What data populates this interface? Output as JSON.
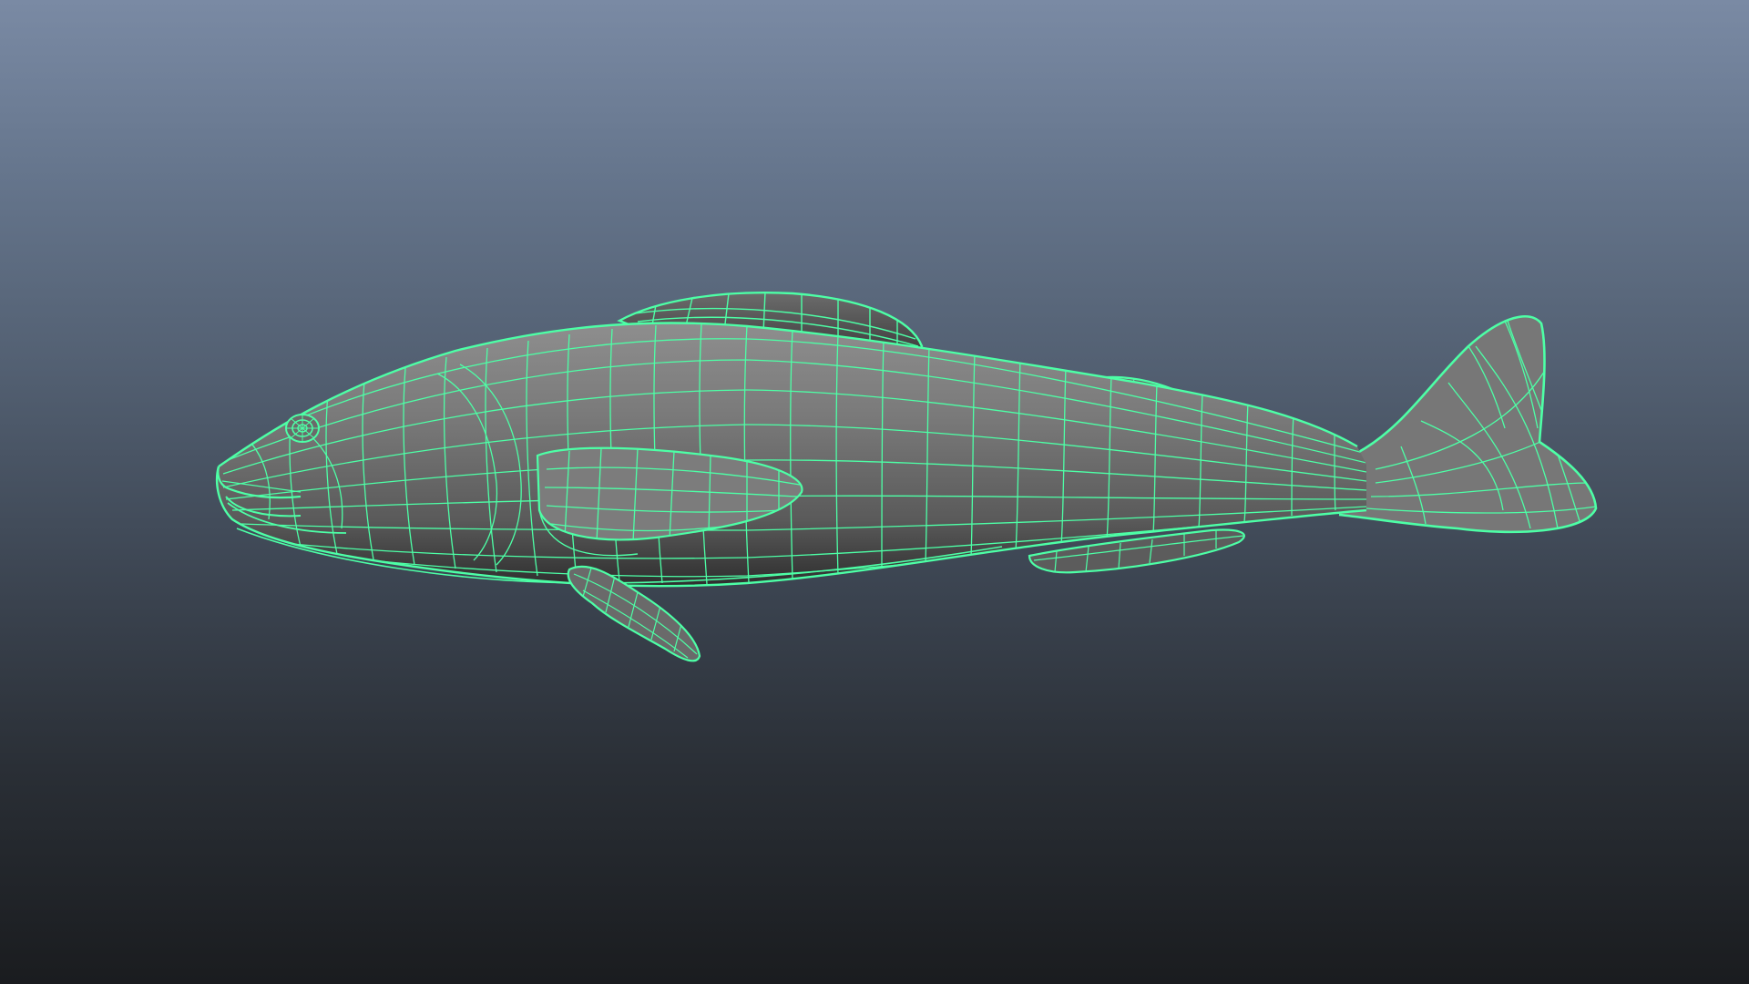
{
  "viewport": {
    "name": "3d-perspective-viewport",
    "background_top": "#7a8aa4",
    "background_bottom": "#1a1c1f"
  },
  "model": {
    "object": "fish-mesh",
    "display_mode": "wireframe-on-shaded",
    "wireframe_color": "#4dffa6",
    "shaded_color": "#808080",
    "selected": true
  }
}
